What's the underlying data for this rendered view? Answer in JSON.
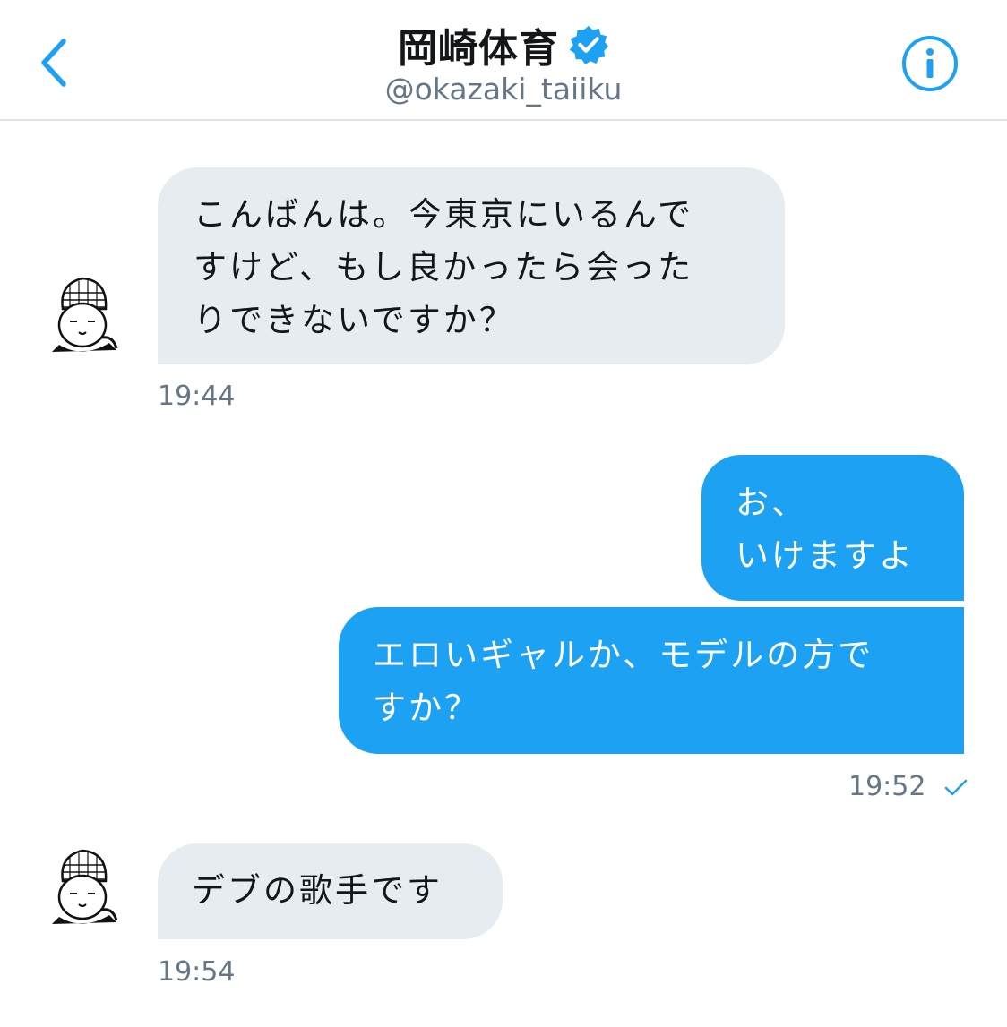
{
  "header": {
    "title": "岡崎体育",
    "handle": "@okazaki_taiiku"
  },
  "messages": [
    {
      "text": "こんばんは。今東京にいるんで\nすけど、もし良かったら会った\nりできないですか？",
      "time": "19:44"
    },
    {
      "text": "お、\nいけますよ"
    },
    {
      "text": "エロいギャルか、モデルの方で\nすか？",
      "time": "19:52"
    },
    {
      "text": "デブの歌手です",
      "time": "19:54"
    }
  ],
  "colors": {
    "accent": "#1da1f2",
    "incoming_bubble": "#e6ecf0",
    "secondary_text": "#657786"
  }
}
